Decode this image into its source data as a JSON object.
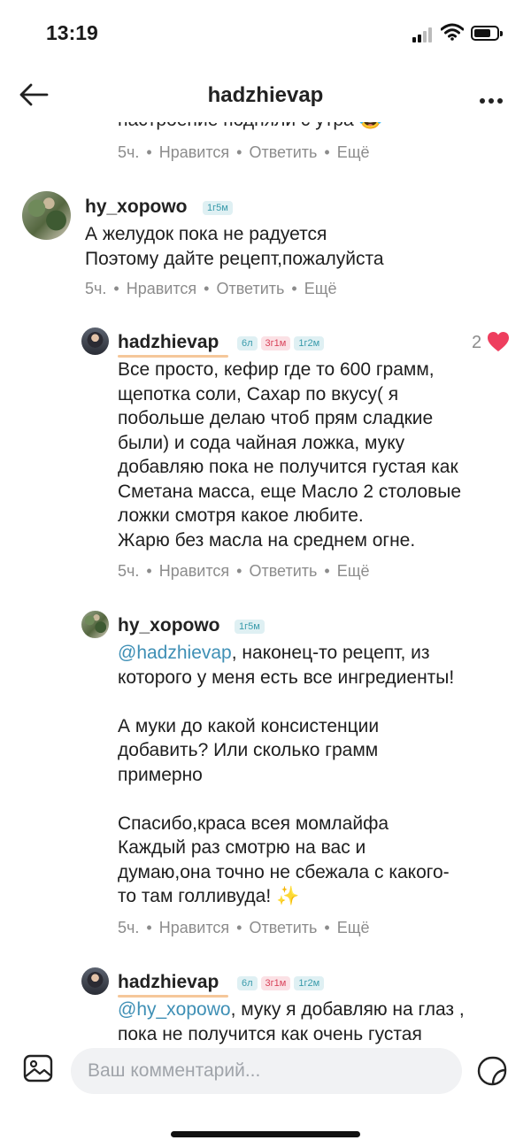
{
  "status": {
    "time": "13:19"
  },
  "header": {
    "title": "hadzhievap"
  },
  "actions": {
    "time": "5ч.",
    "like": "Нравится",
    "reply": "Ответить",
    "more": "Ещё"
  },
  "top_cut": {
    "text": "настроение подняли с утра 😂"
  },
  "comments": [
    {
      "user": "hy_xopowo",
      "badges": [
        "1г5м"
      ],
      "text": "А желудок пока не радуется\nПоэтому дайте рецепт,пожалуйста"
    },
    {
      "user": "hadzhievap",
      "badges": [
        "6л",
        "3г1м",
        "1г2м"
      ],
      "likes": "2",
      "text": "Все просто, кефир где то 600 грамм,\nщепотка соли, Сахар по вкусу( я\nпобольше делаю чтоб прям сладкие\nбыли) и сода чайная ложка, муку\nдобавляю пока не получится густая как\nСметана масса, еще Масло 2 столовые\nложки смотря какое любите.\nЖарю без масла на среднем огне."
    },
    {
      "user": "hy_xopowo",
      "badges": [
        "1г5м"
      ],
      "mention": "@hadzhievap",
      "text": ", наконец-то рецепт, из\nкоторого у меня есть все ингредиенты!\n\nА муки до какой консистенции\nдобавить? Или сколько грамм\nпримерно\n\nСпасибо,краса всея момлайфа\nКаждый раз смотрю на вас и\nдумаю,она точно не сбежала с какого-\nто там голливуда! ✨"
    },
    {
      "user": "hadzhievap",
      "badges": [
        "6л",
        "3г1м",
        "1г2м"
      ],
      "mention": "@hy_xopowo",
      "text": ", муку я добавляю на глаз ,\nпока не получится как очень густая"
    }
  ],
  "composer": {
    "placeholder": "Ваш комментарий..."
  },
  "icons": [
    "back-arrow-icon",
    "more-dots-icon",
    "heart-icon",
    "image-icon",
    "sticker-icon"
  ],
  "colors": {
    "mention": "#3e8fb5",
    "heart": "#ee3e5e",
    "badge_blue": "#3a9bab",
    "badge_red": "#d9435a"
  }
}
